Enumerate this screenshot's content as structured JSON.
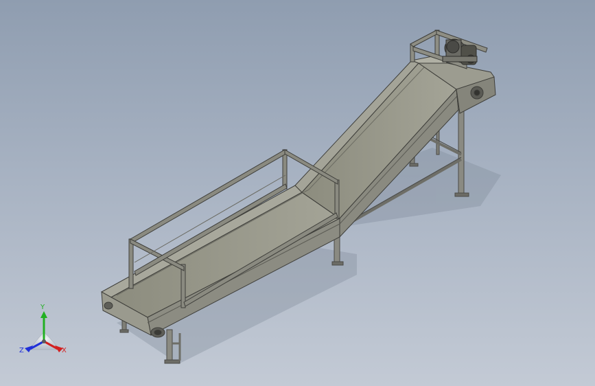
{
  "viewport": {
    "background_top": "#8f9db0",
    "background_bottom": "#c3cad5"
  },
  "triad": {
    "x_label": "X",
    "y_label": "Y",
    "z_label": "Z",
    "x_color": "#d32020",
    "y_color": "#22b022",
    "z_color": "#2030d8"
  }
}
